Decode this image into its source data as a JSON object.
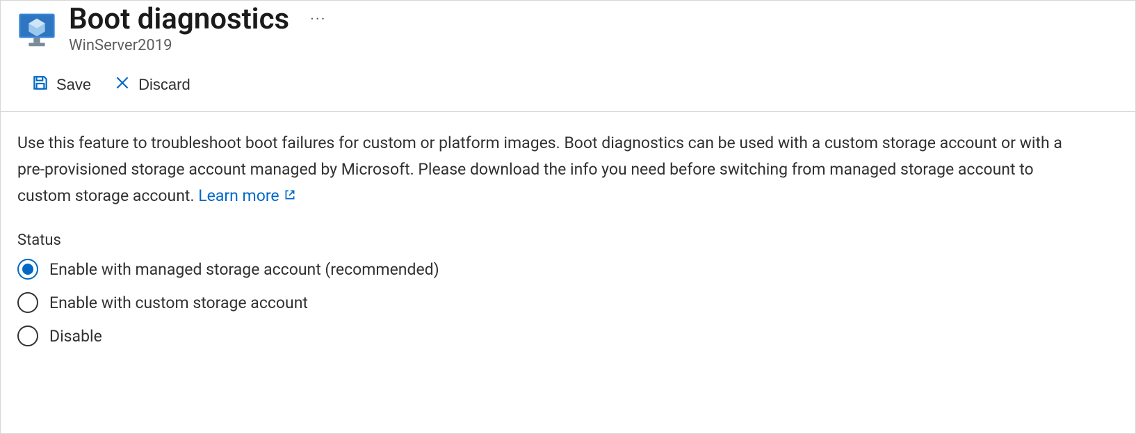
{
  "header": {
    "title": "Boot diagnostics",
    "subtitle": "WinServer2019"
  },
  "toolbar": {
    "save_label": "Save",
    "discard_label": "Discard"
  },
  "description": {
    "text": "Use this feature to troubleshoot boot failures for custom or platform images. Boot diagnostics can be used with a custom storage account or with a pre-provisioned storage account managed by Microsoft. Please download the info you need before switching from managed storage account to custom storage account.",
    "learn_more": "Learn more"
  },
  "status": {
    "label": "Status",
    "options": [
      {
        "label": "Enable with managed storage account (recommended)",
        "selected": true
      },
      {
        "label": "Enable with custom storage account",
        "selected": false
      },
      {
        "label": "Disable",
        "selected": false
      }
    ]
  }
}
